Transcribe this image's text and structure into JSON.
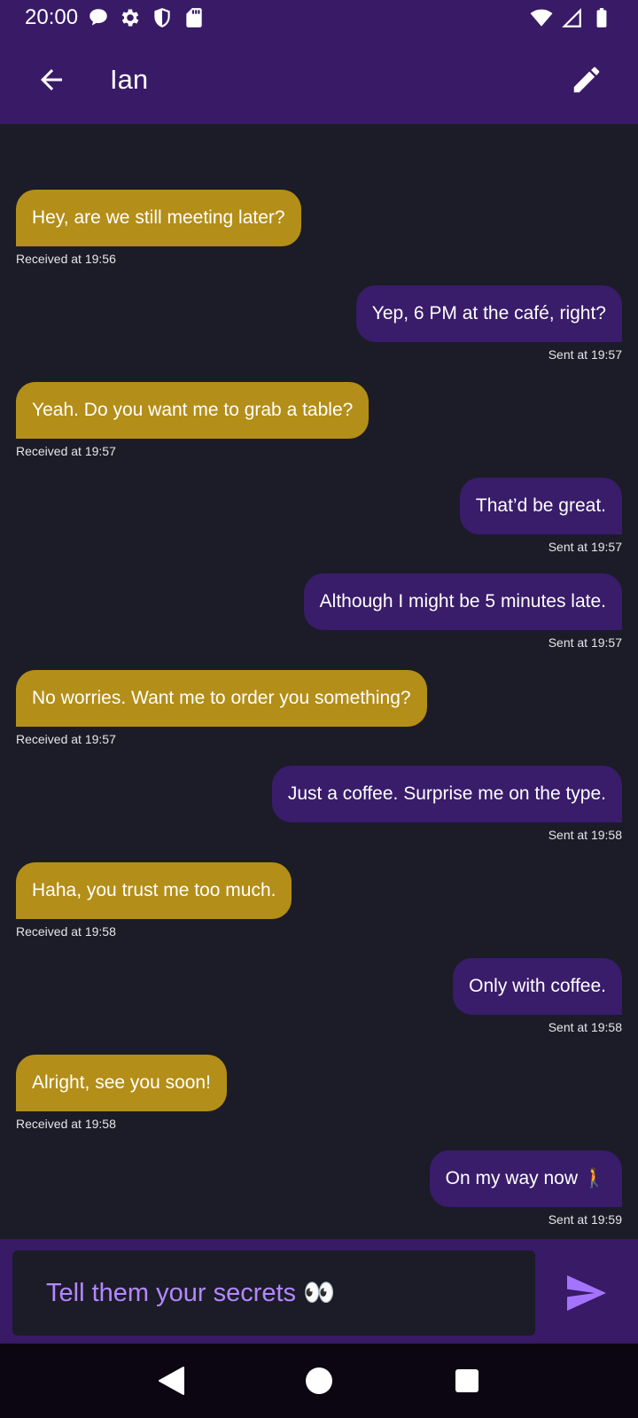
{
  "status_bar": {
    "time": "20:00",
    "left_icons": [
      "chat-bubble-icon",
      "gear-icon",
      "shield-icon",
      "sd-card-icon"
    ],
    "right_icons": [
      "wifi-icon",
      "cell-signal-icon",
      "battery-icon"
    ]
  },
  "app_bar": {
    "title": "Ian",
    "back_icon": "arrow-left-icon",
    "edit_icon": "pencil-icon"
  },
  "messages": [
    {
      "direction": "received",
      "text": "Hey, are we still meeting later?",
      "meta": "Received at 19:56"
    },
    {
      "direction": "sent",
      "text": "Yep, 6 PM at the café, right?",
      "meta": "Sent at 19:57"
    },
    {
      "direction": "received",
      "text": "Yeah. Do you want me to grab a table?",
      "meta": "Received at 19:57"
    },
    {
      "direction": "sent",
      "text": "That’d be great.",
      "meta": "Sent at 19:57"
    },
    {
      "direction": "sent",
      "text": "Although I might be 5 minutes late.",
      "meta": "Sent at 19:57"
    },
    {
      "direction": "received",
      "text": "No worries. Want me to order you something?",
      "meta": "Received at 19:57"
    },
    {
      "direction": "sent",
      "text": "Just a coffee. Surprise me on the type.",
      "meta": "Sent at 19:58"
    },
    {
      "direction": "received",
      "text": "Haha, you trust me too much.",
      "meta": "Received at 19:58"
    },
    {
      "direction": "sent",
      "text": "Only with coffee.",
      "meta": "Sent at 19:58"
    },
    {
      "direction": "received",
      "text": "Alright, see you soon!",
      "meta": "Received at 19:58"
    },
    {
      "direction": "sent",
      "text": "On my way now 🚶",
      "meta": "Sent at 19:59"
    }
  ],
  "composer": {
    "value": "",
    "placeholder": "Tell them your secrets 👀",
    "send_icon": "send-icon"
  },
  "nav_bar": {
    "icons": [
      "back-triangle-icon",
      "home-circle-icon",
      "recents-square-icon"
    ]
  },
  "colors": {
    "bar": "#381a66",
    "background": "#1b1c27",
    "received_bubble": "#b38e18",
    "sent_bubble": "#391c6a",
    "accent": "#a574ff"
  }
}
